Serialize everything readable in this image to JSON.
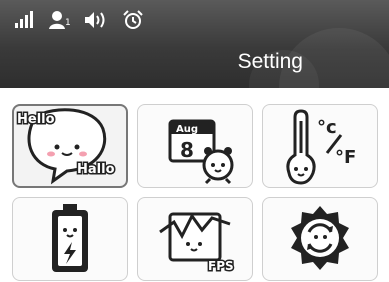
{
  "header": {
    "title": "Setting",
    "status_icons": [
      "signal-icon",
      "user-count-icon",
      "volume-icon",
      "alarm-icon"
    ],
    "user_count": "1"
  },
  "tiles": [
    {
      "name": "language",
      "icon": "speech-bubble-icon",
      "text_top": "Hello",
      "text_bottom": "Hallo",
      "selected": true
    },
    {
      "name": "date-time",
      "icon": "calendar-alarm-icon",
      "month": "Aug",
      "day": "8"
    },
    {
      "name": "temperature-unit",
      "icon": "thermometer-icon",
      "celsius": "°c",
      "fahrenheit": "°F"
    },
    {
      "name": "battery",
      "icon": "battery-icon"
    },
    {
      "name": "fps",
      "icon": "fps-chart-icon",
      "text": "FPS"
    },
    {
      "name": "reset",
      "icon": "reset-flower-icon"
    }
  ],
  "colors": {
    "header_dark": "#3a3a3a",
    "tile_border": "#cfcfcf",
    "icon_stroke": "#222222"
  }
}
